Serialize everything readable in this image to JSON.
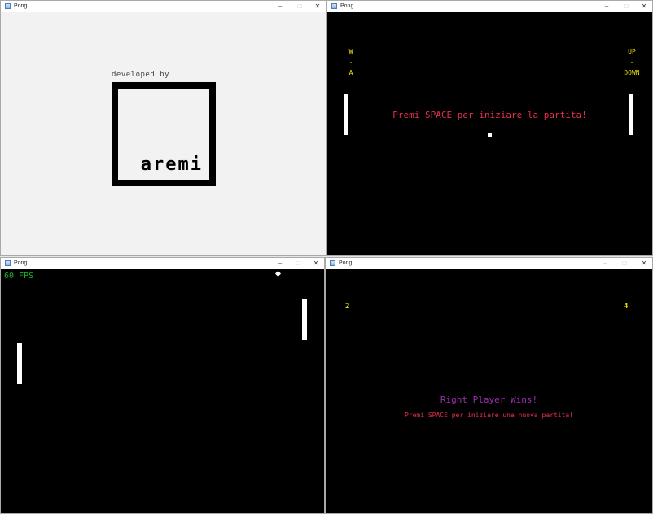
{
  "windows": {
    "splash": {
      "title": "Pong",
      "developed_by": "developed by",
      "logo_text": "aremi"
    },
    "start": {
      "title": "Pong",
      "left_controls": [
        "W",
        "-",
        "A"
      ],
      "right_controls": [
        "UP",
        "-",
        "DOWN"
      ],
      "message": "Premi SPACE per iniziare la partita!"
    },
    "play": {
      "title": "Pong",
      "fps": "60 FPS"
    },
    "win": {
      "title": "Pong",
      "score_left": "2",
      "score_right": "4",
      "winner": "Right Player Wins!",
      "message": "Premi SPACE per iniziare una nuova partita!"
    }
  },
  "controls": {
    "minimize": "–",
    "maximize": "□",
    "close": "✕"
  },
  "colors": {
    "message_red": "#e63050",
    "winner_purple": "#9b2fb0",
    "fps_green": "#1fb52f",
    "labels_yellow": "#e8e000"
  }
}
